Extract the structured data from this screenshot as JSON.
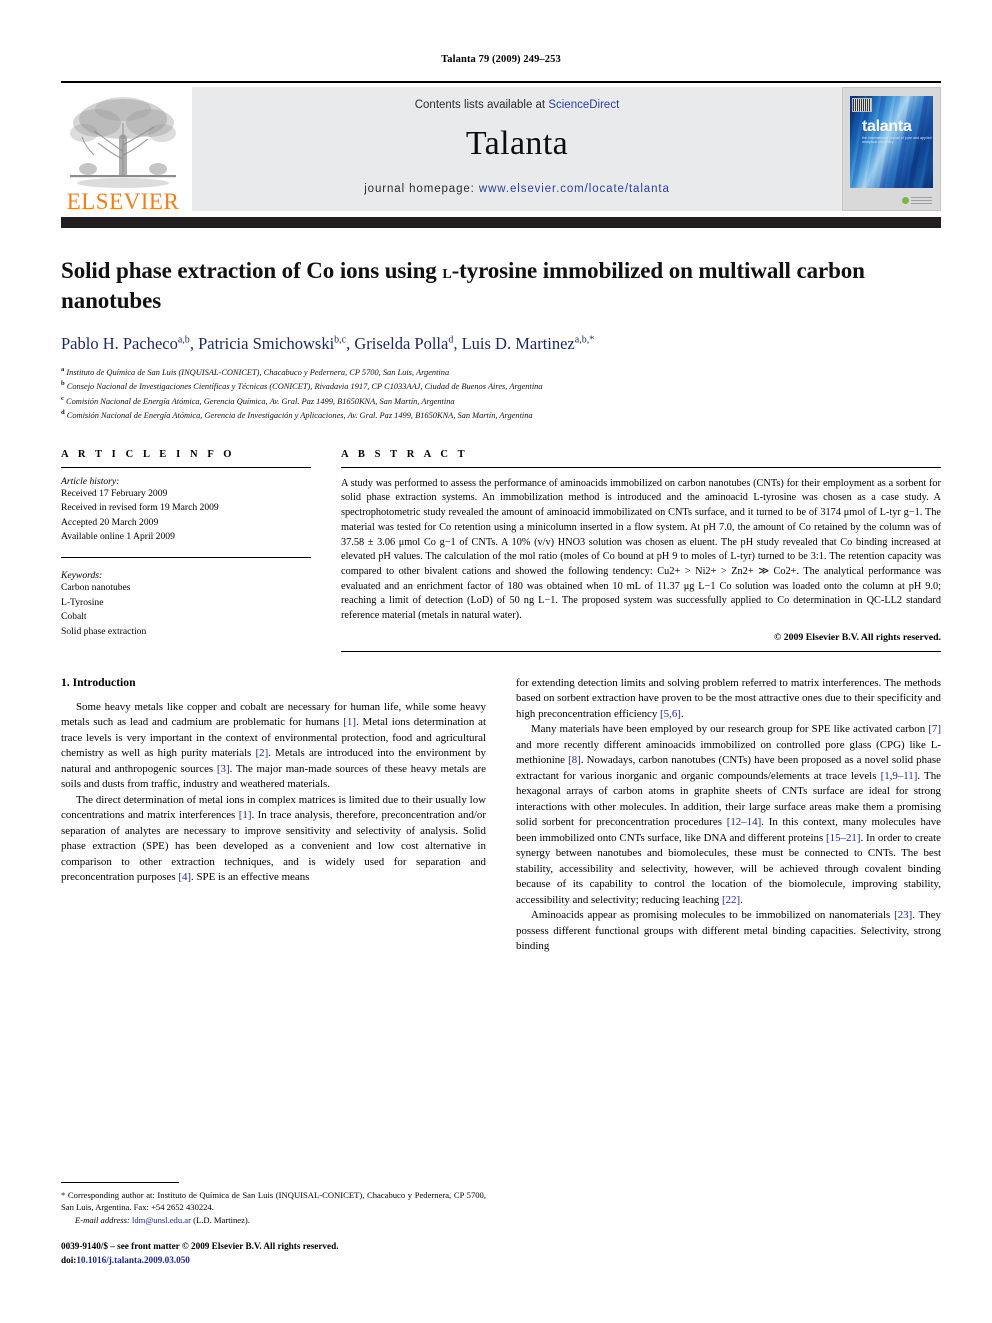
{
  "running_head": "Talanta 79 (2009) 249–253",
  "masthead": {
    "contents_prefix": "Contents lists available at ",
    "sciencedirect": "ScienceDirect",
    "journal_name": "Talanta",
    "homepage_prefix": "journal homepage: ",
    "homepage_url": "www.elsevier.com/locate/talanta",
    "publisher_logo_word": "ELSEVIER",
    "cover_title": "talanta",
    "cover_subtitle": "the international journal of pure and applied analytical chemistry"
  },
  "article": {
    "title_part1": "Solid phase extraction of Co ions using ",
    "title_smallcap": "l",
    "title_part2": "-tyrosine immobilized on multiwall carbon nanotubes",
    "authors": [
      {
        "name": "Pablo H. Pacheco",
        "sup": "a,b"
      },
      {
        "name": "Patricia Smichowski",
        "sup": "b,c"
      },
      {
        "name": "Griselda Polla",
        "sup": "d"
      },
      {
        "name": "Luis D. Martinez",
        "sup": "a,b,*"
      }
    ],
    "affiliations": [
      {
        "mark": "a",
        "text": "Instituto de Química de San Luis (INQUISAL-CONICET), Chacabuco y Pedernera, CP 5700, San Luis, Argentina"
      },
      {
        "mark": "b",
        "text": "Consejo Nacional de Investigaciones Científicas y Técnicas (CONICET), Rivadavia 1917, CP C1033AAJ, Ciudad de Buenos Aires, Argentina"
      },
      {
        "mark": "c",
        "text": "Comisión Nacional de Energía Atómica, Gerencia Química, Av. Gral. Paz 1499, B1650KNA, San Martín, Argentina"
      },
      {
        "mark": "d",
        "text": "Comisión Nacional de Energía Atómica, Gerencia de Investigación y Aplicaciones, Av. Gral. Paz 1499, B1650KNA, San Martín, Argentina"
      }
    ]
  },
  "article_info": {
    "label": "A R T I C L E   I N F O",
    "history_title": "Article history:",
    "history": [
      "Received 17 February 2009",
      "Received in revised form 19 March 2009",
      "Accepted 20 March 2009",
      "Available online 1 April 2009"
    ],
    "keywords_title": "Keywords:",
    "keywords": [
      "Carbon nanotubes",
      "L-Tyrosine",
      "Cobalt",
      "Solid phase extraction"
    ]
  },
  "abstract": {
    "label": "A B S T R A C T",
    "text": "A study was performed to assess the performance of aminoacids immobilized on carbon nanotubes (CNTs) for their employment as a sorbent for solid phase extraction systems. An immobilization method is introduced and the aminoacid L-tyrosine was chosen as a case study. A spectrophotometric study revealed the amount of aminoacid immobilizated on CNTs surface, and it turned to be of 3174 μmol of L-tyr g−1. The material was tested for Co retention using a minicolumn inserted in a flow system. At pH 7.0, the amount of Co retained by the column was of 37.58 ± 3.06 μmol Co g−1 of CNTs. A 10% (v/v) HNO3 solution was chosen as eluent. The pH study revealed that Co binding increased at elevated pH values. The calculation of the mol ratio (moles of Co bound at pH 9 to moles of L-tyr) turned to be 3:1. The retention capacity was compared to other bivalent cations and showed the following tendency: Cu2+ > Ni2+ > Zn2+ ≫ Co2+. The analytical performance was evaluated and an enrichment factor of 180 was obtained when 10 mL of 11.37 μg L−1 Co solution was loaded onto the column at pH 9.0; reaching a limit of detection (LoD) of 50 ng L−1. The proposed system was successfully applied to Co determination in QC-LL2 standard reference material (metals in natural water).",
    "copyright": "© 2009 Elsevier B.V. All rights reserved."
  },
  "body": {
    "section_heading": "1. Introduction",
    "left_paragraphs": [
      "Some heavy metals like copper and cobalt are necessary for human life, while some heavy metals such as lead and cadmium are problematic for humans [1]. Metal ions determination at trace levels is very important in the context of environmental protection, food and agricultural chemistry as well as high purity materials [2]. Metals are introduced into the environment by natural and anthropogenic sources [3]. The major man-made sources of these heavy metals are soils and dusts from traffic, industry and weathered materials.",
      "The direct determination of metal ions in complex matrices is limited due to their usually low concentrations and matrix interferences [1]. In trace analysis, therefore, preconcentration and/or separation of analytes are necessary to improve sensitivity and selectivity of analysis. Solid phase extraction (SPE) has been developed as a convenient and low cost alternative in comparison to other extraction techniques, and is widely used for separation and preconcentration purposes [4]. SPE is an effective means"
    ],
    "right_paragraphs": [
      "for extending detection limits and solving problem referred to matrix interferences. The methods based on sorbent extraction have proven to be the most attractive ones due to their specificity and high preconcentration efficiency [5,6].",
      "Many materials have been employed by our research group for SPE like activated carbon [7] and more recently different aminoacids immobilized on controlled pore glass (CPG) like L-methionine [8]. Nowadays, carbon nanotubes (CNTs) have been proposed as a novel solid phase extractant for various inorganic and organic compounds/elements at trace levels [1,9–11]. The hexagonal arrays of carbon atoms in graphite sheets of CNTs surface are ideal for strong interactions with other molecules. In addition, their large surface areas make them a promising solid sorbent for preconcentration procedures [12–14]. In this context, many molecules have been immobilized onto CNTs surface, like DNA and different proteins [15–21]. In order to create synergy between nanotubes and biomolecules, these must be connected to CNTs. The best stability, accessibility and selectivity, however, will be achieved through covalent binding because of its capability to control the location of the biomolecule, improving stability, accessibility and selectivity; reducing leaching [22].",
      "Aminoacids appear as promising molecules to be immobilized on nanomaterials [23]. They possess different functional groups with different metal binding capacities. Selectivity, strong binding"
    ]
  },
  "footnotes": {
    "corresponding": "* Corresponding author at: Instituto de Química de San Luis (INQUISAL-CONICET), Chacabuco y Pedernera, CP 5700, San Luis, Argentina. Fax: +54 2652 430224.",
    "email_label": "E-mail address:",
    "email": "ldm@unsl.edu.ar",
    "email_suffix": " (L.D. Martinez).",
    "imprint_line1": "0039-9140/$ – see front matter © 2009 Elsevier B.V. All rights reserved.",
    "doi_label": "doi:",
    "doi_value": "10.1016/j.talanta.2009.03.050"
  },
  "colors": {
    "link_blue": "#2b3f9e",
    "ref_blue": "#1b2a8c",
    "elsevier_orange": "#f07f1a",
    "masthead_grey": "#e8eaec",
    "dark_band": "#231f20"
  }
}
